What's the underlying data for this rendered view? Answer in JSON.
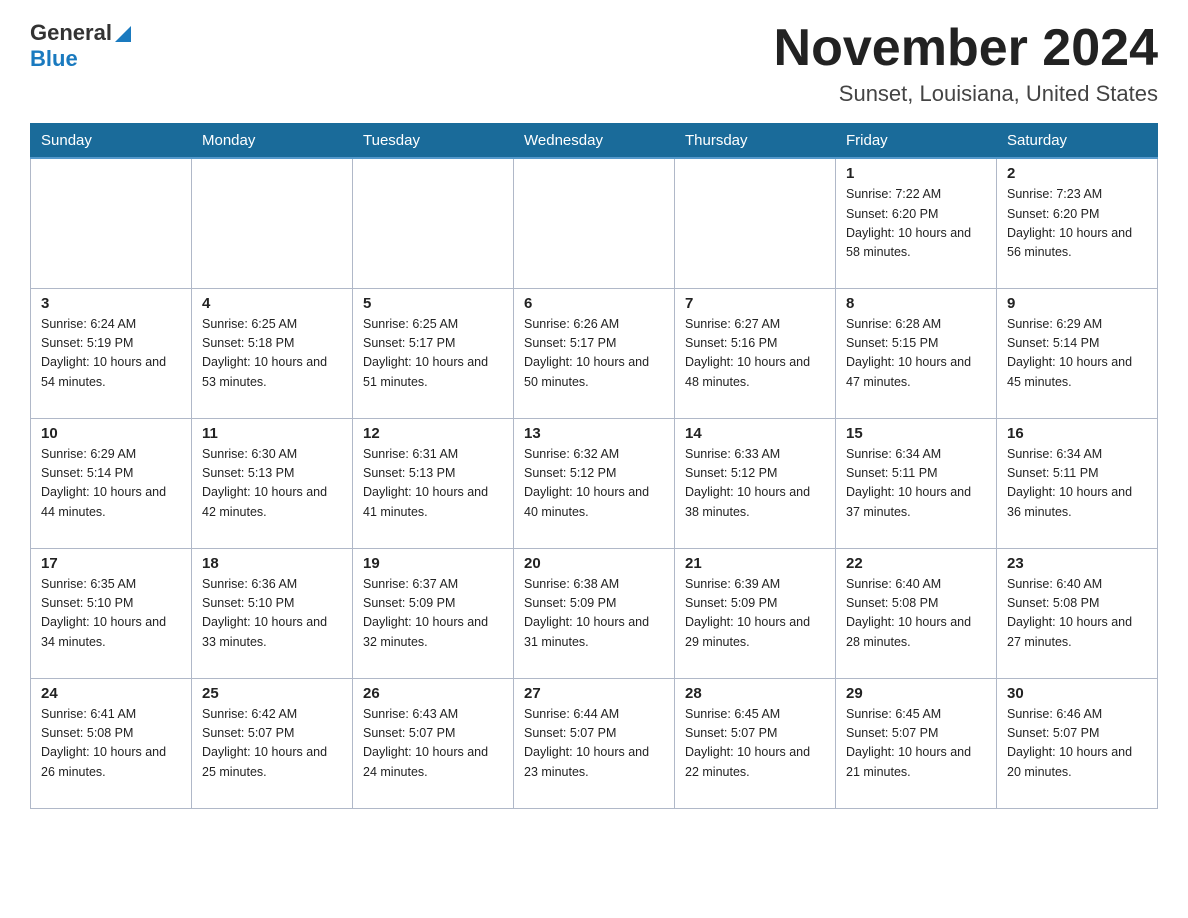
{
  "logo": {
    "text_general": "General",
    "arrow": "▶",
    "text_blue": "Blue"
  },
  "title": "November 2024",
  "subtitle": "Sunset, Louisiana, United States",
  "weekdays": [
    "Sunday",
    "Monday",
    "Tuesday",
    "Wednesday",
    "Thursday",
    "Friday",
    "Saturday"
  ],
  "weeks": [
    [
      {
        "day": "",
        "sunrise": "",
        "sunset": "",
        "daylight": ""
      },
      {
        "day": "",
        "sunrise": "",
        "sunset": "",
        "daylight": ""
      },
      {
        "day": "",
        "sunrise": "",
        "sunset": "",
        "daylight": ""
      },
      {
        "day": "",
        "sunrise": "",
        "sunset": "",
        "daylight": ""
      },
      {
        "day": "",
        "sunrise": "",
        "sunset": "",
        "daylight": ""
      },
      {
        "day": "1",
        "sunrise": "Sunrise: 7:22 AM",
        "sunset": "Sunset: 6:20 PM",
        "daylight": "Daylight: 10 hours and 58 minutes."
      },
      {
        "day": "2",
        "sunrise": "Sunrise: 7:23 AM",
        "sunset": "Sunset: 6:20 PM",
        "daylight": "Daylight: 10 hours and 56 minutes."
      }
    ],
    [
      {
        "day": "3",
        "sunrise": "Sunrise: 6:24 AM",
        "sunset": "Sunset: 5:19 PM",
        "daylight": "Daylight: 10 hours and 54 minutes."
      },
      {
        "day": "4",
        "sunrise": "Sunrise: 6:25 AM",
        "sunset": "Sunset: 5:18 PM",
        "daylight": "Daylight: 10 hours and 53 minutes."
      },
      {
        "day": "5",
        "sunrise": "Sunrise: 6:25 AM",
        "sunset": "Sunset: 5:17 PM",
        "daylight": "Daylight: 10 hours and 51 minutes."
      },
      {
        "day": "6",
        "sunrise": "Sunrise: 6:26 AM",
        "sunset": "Sunset: 5:17 PM",
        "daylight": "Daylight: 10 hours and 50 minutes."
      },
      {
        "day": "7",
        "sunrise": "Sunrise: 6:27 AM",
        "sunset": "Sunset: 5:16 PM",
        "daylight": "Daylight: 10 hours and 48 minutes."
      },
      {
        "day": "8",
        "sunrise": "Sunrise: 6:28 AM",
        "sunset": "Sunset: 5:15 PM",
        "daylight": "Daylight: 10 hours and 47 minutes."
      },
      {
        "day": "9",
        "sunrise": "Sunrise: 6:29 AM",
        "sunset": "Sunset: 5:14 PM",
        "daylight": "Daylight: 10 hours and 45 minutes."
      }
    ],
    [
      {
        "day": "10",
        "sunrise": "Sunrise: 6:29 AM",
        "sunset": "Sunset: 5:14 PM",
        "daylight": "Daylight: 10 hours and 44 minutes."
      },
      {
        "day": "11",
        "sunrise": "Sunrise: 6:30 AM",
        "sunset": "Sunset: 5:13 PM",
        "daylight": "Daylight: 10 hours and 42 minutes."
      },
      {
        "day": "12",
        "sunrise": "Sunrise: 6:31 AM",
        "sunset": "Sunset: 5:13 PM",
        "daylight": "Daylight: 10 hours and 41 minutes."
      },
      {
        "day": "13",
        "sunrise": "Sunrise: 6:32 AM",
        "sunset": "Sunset: 5:12 PM",
        "daylight": "Daylight: 10 hours and 40 minutes."
      },
      {
        "day": "14",
        "sunrise": "Sunrise: 6:33 AM",
        "sunset": "Sunset: 5:12 PM",
        "daylight": "Daylight: 10 hours and 38 minutes."
      },
      {
        "day": "15",
        "sunrise": "Sunrise: 6:34 AM",
        "sunset": "Sunset: 5:11 PM",
        "daylight": "Daylight: 10 hours and 37 minutes."
      },
      {
        "day": "16",
        "sunrise": "Sunrise: 6:34 AM",
        "sunset": "Sunset: 5:11 PM",
        "daylight": "Daylight: 10 hours and 36 minutes."
      }
    ],
    [
      {
        "day": "17",
        "sunrise": "Sunrise: 6:35 AM",
        "sunset": "Sunset: 5:10 PM",
        "daylight": "Daylight: 10 hours and 34 minutes."
      },
      {
        "day": "18",
        "sunrise": "Sunrise: 6:36 AM",
        "sunset": "Sunset: 5:10 PM",
        "daylight": "Daylight: 10 hours and 33 minutes."
      },
      {
        "day": "19",
        "sunrise": "Sunrise: 6:37 AM",
        "sunset": "Sunset: 5:09 PM",
        "daylight": "Daylight: 10 hours and 32 minutes."
      },
      {
        "day": "20",
        "sunrise": "Sunrise: 6:38 AM",
        "sunset": "Sunset: 5:09 PM",
        "daylight": "Daylight: 10 hours and 31 minutes."
      },
      {
        "day": "21",
        "sunrise": "Sunrise: 6:39 AM",
        "sunset": "Sunset: 5:09 PM",
        "daylight": "Daylight: 10 hours and 29 minutes."
      },
      {
        "day": "22",
        "sunrise": "Sunrise: 6:40 AM",
        "sunset": "Sunset: 5:08 PM",
        "daylight": "Daylight: 10 hours and 28 minutes."
      },
      {
        "day": "23",
        "sunrise": "Sunrise: 6:40 AM",
        "sunset": "Sunset: 5:08 PM",
        "daylight": "Daylight: 10 hours and 27 minutes."
      }
    ],
    [
      {
        "day": "24",
        "sunrise": "Sunrise: 6:41 AM",
        "sunset": "Sunset: 5:08 PM",
        "daylight": "Daylight: 10 hours and 26 minutes."
      },
      {
        "day": "25",
        "sunrise": "Sunrise: 6:42 AM",
        "sunset": "Sunset: 5:07 PM",
        "daylight": "Daylight: 10 hours and 25 minutes."
      },
      {
        "day": "26",
        "sunrise": "Sunrise: 6:43 AM",
        "sunset": "Sunset: 5:07 PM",
        "daylight": "Daylight: 10 hours and 24 minutes."
      },
      {
        "day": "27",
        "sunrise": "Sunrise: 6:44 AM",
        "sunset": "Sunset: 5:07 PM",
        "daylight": "Daylight: 10 hours and 23 minutes."
      },
      {
        "day": "28",
        "sunrise": "Sunrise: 6:45 AM",
        "sunset": "Sunset: 5:07 PM",
        "daylight": "Daylight: 10 hours and 22 minutes."
      },
      {
        "day": "29",
        "sunrise": "Sunrise: 6:45 AM",
        "sunset": "Sunset: 5:07 PM",
        "daylight": "Daylight: 10 hours and 21 minutes."
      },
      {
        "day": "30",
        "sunrise": "Sunrise: 6:46 AM",
        "sunset": "Sunset: 5:07 PM",
        "daylight": "Daylight: 10 hours and 20 minutes."
      }
    ]
  ]
}
